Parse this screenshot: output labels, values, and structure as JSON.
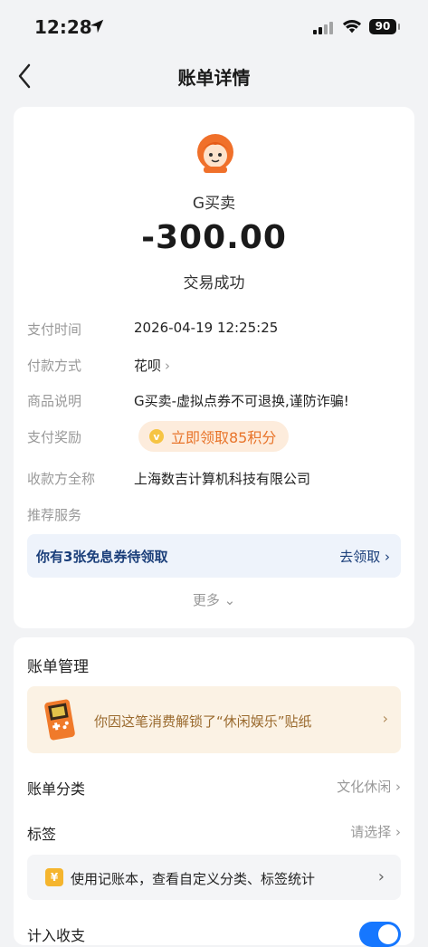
{
  "status_bar": {
    "time": "12:28",
    "battery": "90"
  },
  "nav": {
    "title": "账单详情"
  },
  "bill": {
    "merchant": "G买卖",
    "amount": "-300.00",
    "status": "交易成功",
    "rows": {
      "pay_time": {
        "label": "支付时间",
        "value": "2026-04-19 12:25:25"
      },
      "pay_method": {
        "label": "付款方式",
        "value": "花呗"
      },
      "description": {
        "label": "商品说明",
        "value": "G买卖-虚拟点券不可退换,谨防诈骗!"
      },
      "reward": {
        "label": "支付奖励",
        "value": "立即领取85积分"
      },
      "payee": {
        "label": "收款方全称",
        "value": "上海数吉计算机科技有限公司"
      },
      "services": {
        "label": "推荐服务"
      }
    },
    "coupon": {
      "text": "你有3张免息券待领取",
      "action": "去领取"
    },
    "more": "更多"
  },
  "management": {
    "title": "账单管理",
    "sticker_text": "你因这笔消费解锁了“休闲娱乐”贴纸",
    "category": {
      "label": "账单分类",
      "value": "文化休闲"
    },
    "tags": {
      "label": "标签",
      "value": "请选择"
    },
    "notebook_text": "使用记账本，查看自定义分类、标签统计",
    "partial_label": "计入收支"
  },
  "colors": {
    "accent": "#1677ff",
    "reward": "#e8742a",
    "coupon_text": "#1b3f7a"
  }
}
